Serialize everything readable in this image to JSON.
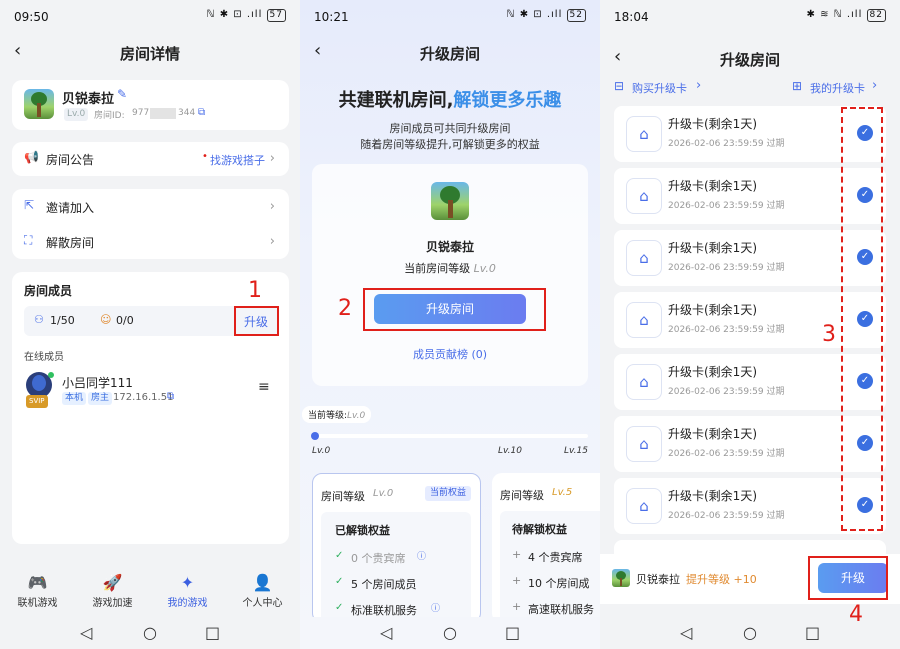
{
  "panel1": {
    "status": {
      "time": "09:50",
      "battery": "57"
    },
    "nav_title": "房间详情",
    "room": {
      "name": "贝锐泰拉",
      "level": "Lv.0",
      "id_label": "房间ID:",
      "id_value": "977",
      "id_suffix": "344"
    },
    "announcement": {
      "label": "房间公告",
      "action": "找游戏搭子"
    },
    "menu": [
      {
        "label": "邀请加入"
      },
      {
        "label": "解散房间"
      }
    ],
    "members": {
      "title": "房间成员",
      "count": "1/50",
      "guests": "0/0",
      "upgrade": "升级",
      "online_title": "在线成员"
    },
    "member": {
      "name": "小吕同学111",
      "tag_self": "本机",
      "tag_owner": "房主",
      "ip": "172.16.1.51",
      "badge": "SVIP"
    },
    "tabs": [
      "联机游戏",
      "游戏加速",
      "我的游戏",
      "个人中心"
    ],
    "annotation": "1"
  },
  "panel2": {
    "status": {
      "time": "10:21",
      "battery": "52"
    },
    "nav_title": "升级房间",
    "headline_a": "共建联机房间,",
    "headline_b": "解锁更多乐趣",
    "sub1": "房间成员可共同升级房间",
    "sub2": "随着房间等级提升,可解锁更多的权益",
    "room_name": "贝锐泰拉",
    "level_label": "当前房间等级",
    "level_value": "Lv.0",
    "upgrade_button": "升级房间",
    "contrib": "成员贡献榜 (0)",
    "progress": {
      "label": "当前等级:",
      "level": "Lv.0",
      "ticks": [
        "Lv.0",
        "Lv.10",
        "Lv.15"
      ],
      "fraction": 0.0
    },
    "benefit_left": {
      "title": "房间等级",
      "level": "Lv.0",
      "badge": "当前权益",
      "section": "已解锁权益",
      "items": [
        "0 个贵宾席",
        "5 个房间成员",
        "标准联机服务"
      ]
    },
    "benefit_right": {
      "title": "房间等级",
      "level": "Lv.5",
      "section": "待解锁权益",
      "items": [
        "4 个贵宾席",
        "10 个房间成",
        "高速联机服务"
      ]
    },
    "annotation": "2"
  },
  "panel3": {
    "status": {
      "time": "18:04",
      "battery": "82"
    },
    "nav_title": "升级房间",
    "buy_link": "购买升级卡",
    "my_link": "我的升级卡",
    "cards": [
      {
        "name": "升级卡(剩余1天)",
        "expire": "2026-02-06 23:59:59 过期"
      },
      {
        "name": "升级卡(剩余1天)",
        "expire": "2026-02-06 23:59:59 过期"
      },
      {
        "name": "升级卡(剩余1天)",
        "expire": "2026-02-06 23:59:59 过期"
      },
      {
        "name": "升级卡(剩余1天)",
        "expire": "2026-02-06 23:59:59 过期"
      },
      {
        "name": "升级卡(剩余1天)",
        "expire": "2026-02-06 23:59:59 过期"
      },
      {
        "name": "升级卡(剩余1天)",
        "expire": "2026-02-06 23:59:59 过期"
      },
      {
        "name": "升级卡(剩余1天)",
        "expire": "2026-02-06 23:59:59 过期"
      }
    ],
    "footer": {
      "room": "贝锐泰拉",
      "gain": "提升等级 +10",
      "button": "升级"
    },
    "annotation_a": "3",
    "annotation_b": "4"
  },
  "colors": {
    "accent": "#4a6ee8",
    "annotation_red": "#e0201a",
    "gradient_button": "#6b7cf0"
  }
}
